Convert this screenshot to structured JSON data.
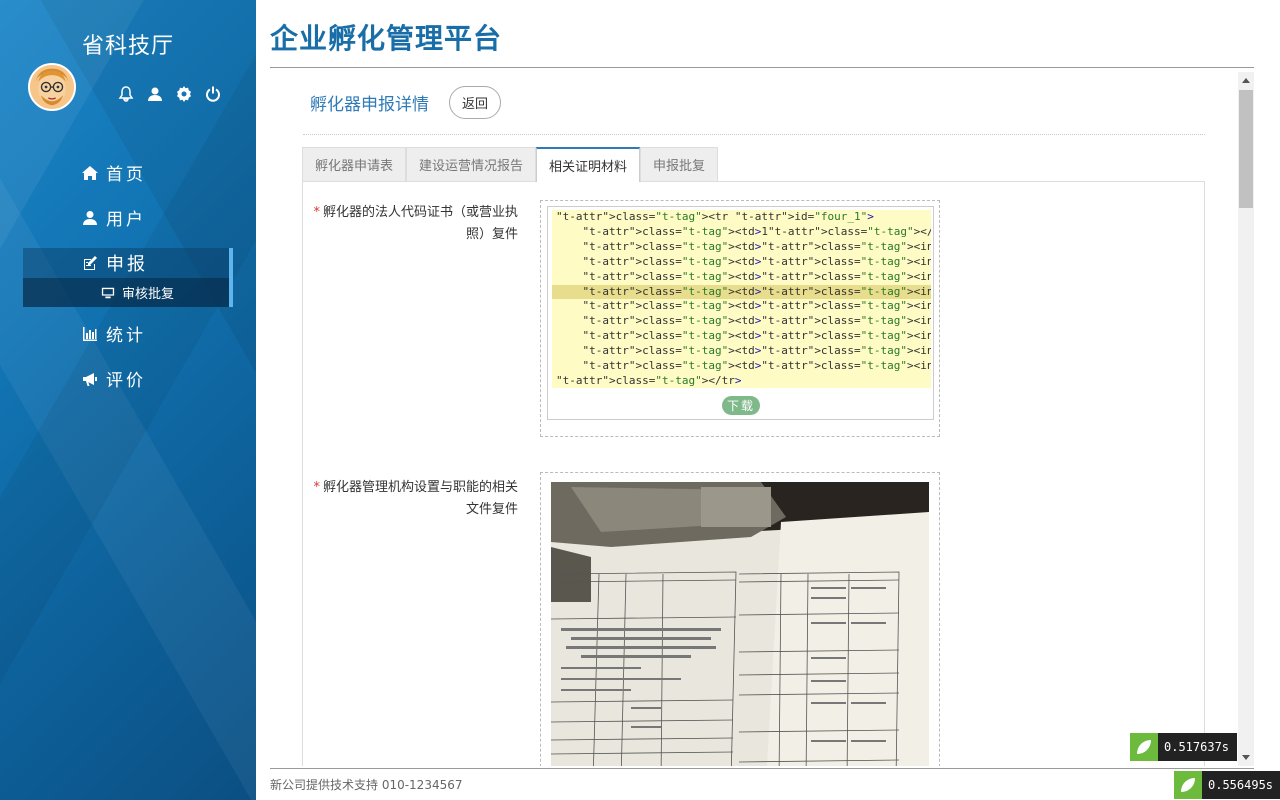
{
  "sidebar": {
    "brand": "省科技厅",
    "icons": [
      "bell-icon",
      "user-icon",
      "gear-icon",
      "power-icon"
    ],
    "items": [
      {
        "label": "首页",
        "icon": "home-icon"
      },
      {
        "label": "用户",
        "icon": "user-icon"
      },
      {
        "label": "申报",
        "icon": "edit-icon",
        "active": true
      },
      {
        "label": "统计",
        "icon": "bar-chart-icon"
      },
      {
        "label": "评价",
        "icon": "megaphone-icon"
      }
    ],
    "subitem": {
      "label": "审核批复",
      "icon": "monitor-icon"
    }
  },
  "header": {
    "title": "企业孵化管理平台"
  },
  "detail": {
    "title": "孵化器申报详情",
    "back_label": "返回",
    "tabs": [
      "孵化器申请表",
      "建设运营情况报告",
      "相关证明材料",
      "申报批复"
    ],
    "active_tab": 2,
    "fields": [
      {
        "required_mark": "*",
        "label": "孵化器的法人代码证书（或营业执照）复件",
        "download_label": "下载"
      },
      {
        "required_mark": "*",
        "label": "孵化器管理机构设置与职能的相关文件复件"
      }
    ],
    "code_lines": [
      "<tr id=\"four_1\">",
      "    <td>1</td>",
      "    <td><input type=\"text\" id=\"f_name\" autocomplete=\"",
      "    <td><input type=\"text\" autocomplete=\"off\" id=\"fou",
      "    <td><input type=\"text\" autocomplete=\"off\" id=\"fou",
      "    <td><input type=\"text\" id=\"f_money\" autocomplete=",
      "    <td><input type=\"text\" id=\"tec_area\" autocomplete",
      "    <td><input type=\"text\" id=\"f_area\" autocomplete=\"",
      "    <td><input type=\"text\" id=\"f_get\" autocomplete=\"o",
      "    <td><input type=\"number\" id=\"f_person\" autocomple",
      "    <td><input type=\"number\" id=\"f_count\" autocomplet",
      "</tr>"
    ],
    "highlight_line": 5
  },
  "footer": {
    "text": "新公司提供技术支持 010-1234567"
  },
  "timers": [
    "0.517637s",
    "0.556495s"
  ],
  "colors": {
    "accent": "#2f7bb8",
    "title": "#1a6ea8",
    "download": "#7fb98a"
  }
}
